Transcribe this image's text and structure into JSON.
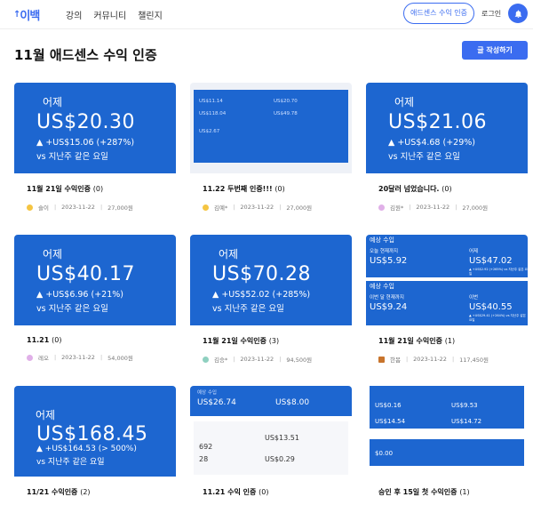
{
  "header": {
    "logo": "이백",
    "nav": [
      "강의",
      "커뮤니티",
      "챌린지"
    ],
    "cert_button": "애드센스 수익 인증",
    "login": "로그인"
  },
  "page": {
    "title": "11월 애드센스 수익 인증",
    "write_button": "글 작성하기"
  },
  "cards": [
    {
      "thumb": {
        "label": "어제",
        "amount": "US$20.30",
        "change": "▲ +US$15.06 (+287%)",
        "compare": "vs 지난주 같은 요일"
      },
      "title": "11월 21일 수익인증",
      "count": "(0)",
      "author": "슬이",
      "date": "2023-11-22",
      "points": "27,000원",
      "avatar_color": "#f5c542"
    },
    {
      "thumb": {
        "texts": [
          "US$11.14",
          "US$118.04",
          "US$20.70",
          "US$49.78",
          "US$2.67"
        ]
      },
      "title": "11.22 두번째 인증!!!",
      "count": "(0)",
      "author": "김예*",
      "date": "2023-11-22",
      "points": "27,000원",
      "avatar_color": "#f5c542"
    },
    {
      "thumb": {
        "label": "어제",
        "amount": "US$21.06",
        "change": "▲ +US$4.68 (+29%)",
        "compare": "vs 지난주 같은 요일"
      },
      "title": "20달러 넘었습니다.",
      "count": "(0)",
      "author": "김원*",
      "date": "2023-11-22",
      "points": "27,000원",
      "avatar_color": "#e0b0e8"
    },
    {
      "thumb": {
        "label": "어제",
        "amount": "US$40.17",
        "change": "▲ +US$6.96 (+21%)",
        "compare": "vs 지난주 같은 요일"
      },
      "title": "11.21",
      "count": "(0)",
      "author": "레오",
      "date": "2023-11-22",
      "points": "54,000원",
      "avatar_color": "#e0b0e8"
    },
    {
      "thumb": {
        "label": "어제",
        "amount": "US$70.28",
        "change": "▲ +US$52.02 (+285%)",
        "compare": "vs 지난주 같은 요일"
      },
      "title": "11월 21일 수익인증",
      "count": "(3)",
      "author": "김승*",
      "date": "2023-11-22",
      "points": "94,500원",
      "avatar_color": "#8fd0c0"
    },
    {
      "thumb": {
        "top_label": "예상 수입",
        "r1": [
          {
            "lbl": "오늘 현재까지",
            "val": "US$5.92",
            "chg": ""
          },
          {
            "lbl": "어제",
            "val": "US$47.02",
            "chg": "▲ +US$2.92 (+265%) vs 지난주 같은 요일"
          }
        ],
        "mid_label": "예상 수입",
        "r2": [
          {
            "lbl": "이번 달 현재까지",
            "val": "US$9.24",
            "chg": ""
          },
          {
            "lbl": "이번",
            "val": "US$40.55",
            "chg": "▲ +US$29.41 (+264%) vs 지난주 같은 요일"
          }
        ]
      },
      "title": "11월 21일 수익인증",
      "count": "(1)",
      "author": "한봄",
      "date": "2023-11-22",
      "points": "117,450원",
      "avatar_color": "#c8742c"
    },
    {
      "thumb": {
        "label": "어제",
        "amount": "US$168.45",
        "change": "▲ +US$164.53 (> 500%)",
        "compare": "vs 지난주 같은 요일"
      },
      "title": "11/21 수익인증",
      "count": "(2)",
      "author": "",
      "date": "",
      "points": "",
      "avatar_color": "#e0b0e8"
    },
    {
      "thumb": {
        "texts": [
          "예상 수입",
          "US$26.74",
          "US$8.00",
          "US$13.51",
          "692",
          "28",
          "US$0.29"
        ]
      },
      "title": "11.21 수익 인증",
      "count": "(0)",
      "author": "",
      "date": "",
      "points": "",
      "avatar_color": "#8fd0c0"
    },
    {
      "thumb": {
        "texts": [
          "US$0.16",
          "US$9.53",
          "US$14.54",
          "US$14.72",
          "$0.00"
        ]
      },
      "title": "승인 후 15일 첫 수익인증",
      "count": "(1)",
      "author": "",
      "date": "",
      "points": "",
      "avatar_color": "#f5c542"
    }
  ]
}
